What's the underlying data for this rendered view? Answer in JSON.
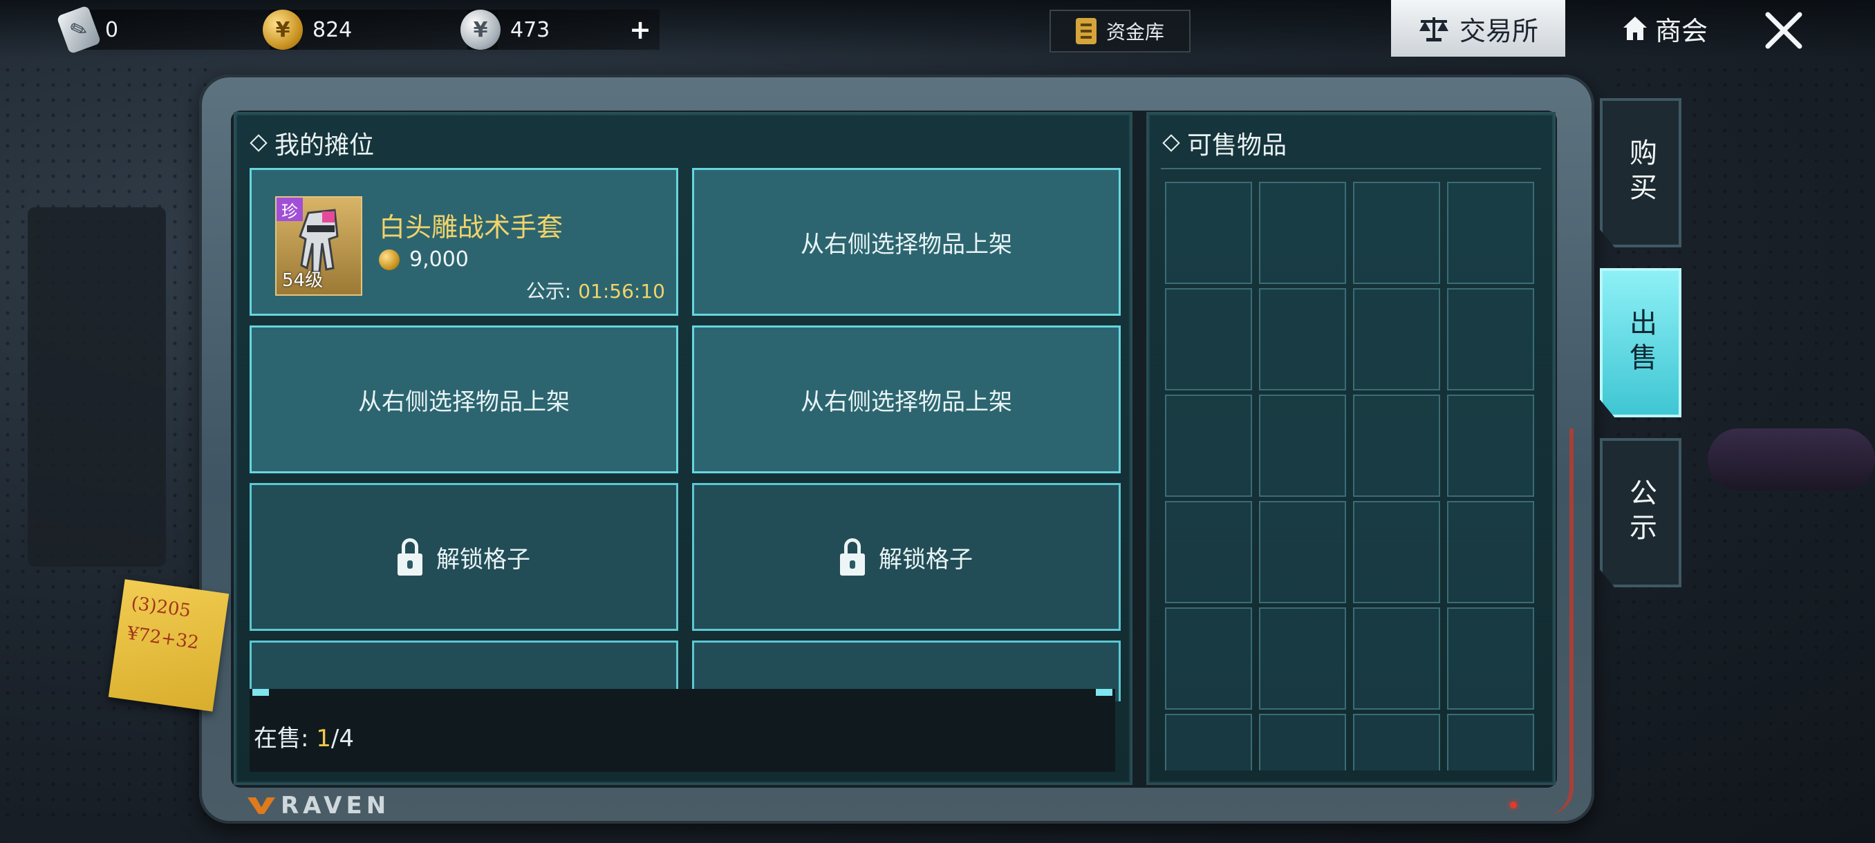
{
  "currencies": [
    {
      "icon": "voucher-icon",
      "value": "0",
      "plus": "+"
    },
    {
      "icon": "gold-coin-icon",
      "value": "824",
      "plus": "+"
    },
    {
      "icon": "silver-coin-icon",
      "value": "473",
      "plus": "+"
    }
  ],
  "vault": {
    "label": "资金库"
  },
  "nav": {
    "exchange": "交易所",
    "guild": "商会"
  },
  "my_stall": {
    "title": "我的摊位",
    "item": {
      "rarity": "珍",
      "level": "54级",
      "name": "白头雕战术手套",
      "price": "9,000",
      "timer_label": "公示:",
      "timer_value": "01:56:10"
    },
    "empty_slot_text": "从右侧选择物品上架",
    "locked_slot_text": "解锁格子",
    "on_sale_label": "在售:",
    "on_sale_count": "1",
    "on_sale_total": "/4"
  },
  "sellable": {
    "title": "可售物品"
  },
  "side_tabs": {
    "buy": "购买",
    "sell": "出售",
    "public": "公示"
  },
  "brand": "RAVEN",
  "note": {
    "line1": "(3)205",
    "line2": "¥72+32"
  },
  "colors": {
    "accent": "#66d6df",
    "gold_text": "#f3d36a",
    "rarity": "#a14fd7"
  }
}
